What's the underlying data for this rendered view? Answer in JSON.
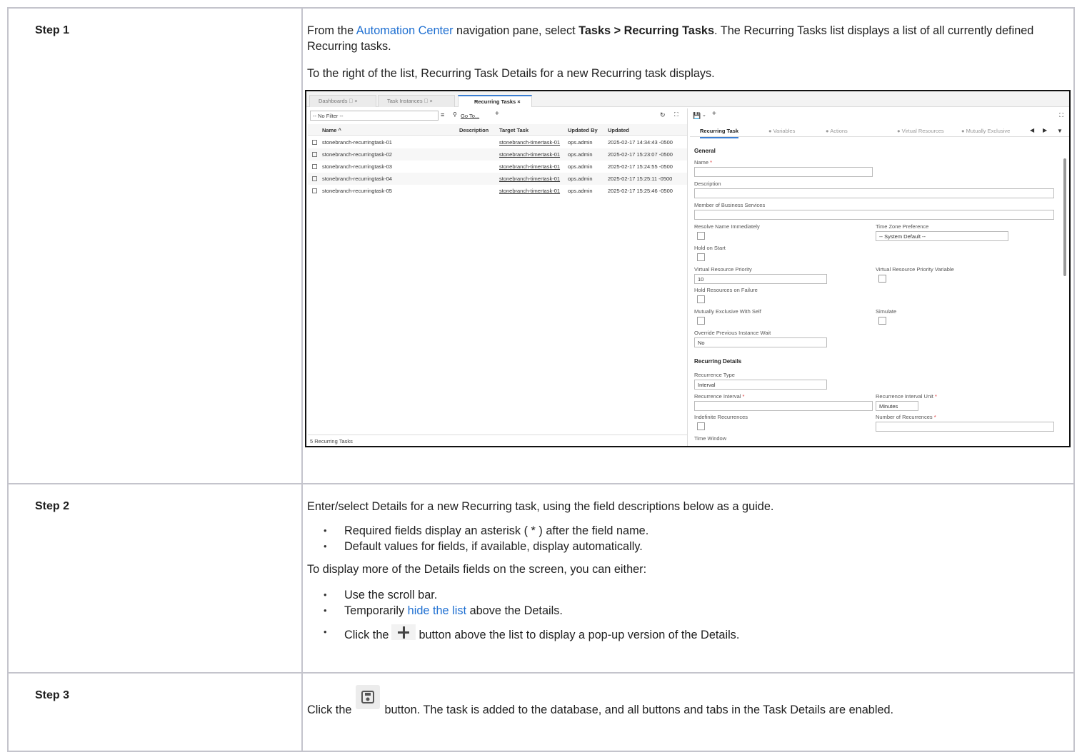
{
  "steps": [
    {
      "label": "Step 1",
      "p1_pre": "From the ",
      "p1_link": "Automation Center",
      "p1_mid": " navigation pane, select ",
      "p1_bold": "Tasks > Recurring Tasks",
      "p1_post": ". The Recurring Tasks list displays a list of all currently defined Recurring tasks.",
      "p2": "To the right of the list, Recurring Task Details for a new Recurring task displays."
    },
    {
      "label": "Step 2",
      "p1": "Enter/select Details for a new Recurring task, using the field descriptions below as a guide.",
      "bullets1": [
        "Required fields display an asterisk ( * ) after the field name.",
        "Default values for fields, if available, display automatically."
      ],
      "p2": "To display more of the Details fields on the screen, you can either:",
      "b_scroll": "Use the scroll bar.",
      "b_hide_pre": "Temporarily ",
      "b_hide_link": "hide the list",
      "b_hide_post": " above the Details.",
      "b_click_pre": "Click the",
      "b_click_post": "button above the list to display a pop-up version of the Details."
    },
    {
      "label": "Step 3",
      "p_pre": "Click the",
      "p_post": "button. The task is added to the database, and all buttons and tabs in the Task Details are enabled."
    }
  ],
  "screenshot": {
    "tabs": [
      "Dashboards ⃠ ×",
      "Task Instances ⃠ ×",
      "Recurring Tasks ×"
    ],
    "filter": "-- No Filter --",
    "goto": "Go To...",
    "columns": [
      "Name ^",
      "Description",
      "Target Task",
      "Updated By",
      "Updated"
    ],
    "rows": [
      {
        "name": "stonebranch-recurringtask-01",
        "target": "stonebranch-timertask-01",
        "by": "ops.admin",
        "updated": "2025-02-17 14:34:43 -0500"
      },
      {
        "name": "stonebranch-recurringtask-02",
        "target": "stonebranch-timertask-01",
        "by": "ops.admin",
        "updated": "2025-02-17 15:23:07 -0500"
      },
      {
        "name": "stonebranch-recurringtask-03",
        "target": "stonebranch-timertask-01",
        "by": "ops.admin",
        "updated": "2025-02-17 15:24:55 -0500"
      },
      {
        "name": "stonebranch-recurringtask-04",
        "target": "stonebranch-timertask-01",
        "by": "ops.admin",
        "updated": "2025-02-17 15:25:11 -0500"
      },
      {
        "name": "stonebranch-recurringtask-05",
        "target": "stonebranch-timertask-01",
        "by": "ops.admin",
        "updated": "2025-02-17 15:25:46 -0500"
      }
    ],
    "footer": "5 Recurring Tasks",
    "detail_tabs": [
      "Recurring Task",
      "● Variables",
      "● Actions",
      "● Virtual Resources",
      "● Mutually Exclusive"
    ],
    "form": {
      "general": "General",
      "name": "Name",
      "description": "Description",
      "member": "Member of Business Services",
      "resolve": "Resolve Name Immediately",
      "tz": "Time Zone Preference",
      "tz_value": "-- System Default --",
      "hold_start": "Hold on Start",
      "vr_priority": "Virtual Resource Priority",
      "vr_priority_value": "10",
      "vr_priority_var": "Virtual Resource Priority Variable",
      "hold_resources": "Hold Resources on Failure",
      "mutex_self": "Mutually Exclusive With Self",
      "simulate": "Simulate",
      "override": "Override Previous Instance Wait",
      "override_value": "No",
      "recurring_details": "Recurring Details",
      "rec_type": "Recurrence Type",
      "rec_type_value": "Interval",
      "rec_interval": "Recurrence Interval",
      "rec_unit": "Recurrence Interval Unit",
      "rec_unit_value": "Minutes",
      "indefinite": "Indefinite Recurrences",
      "num_rec": "Number of Recurrences",
      "time_window": "Time Window",
      "asterisk": "*"
    }
  }
}
